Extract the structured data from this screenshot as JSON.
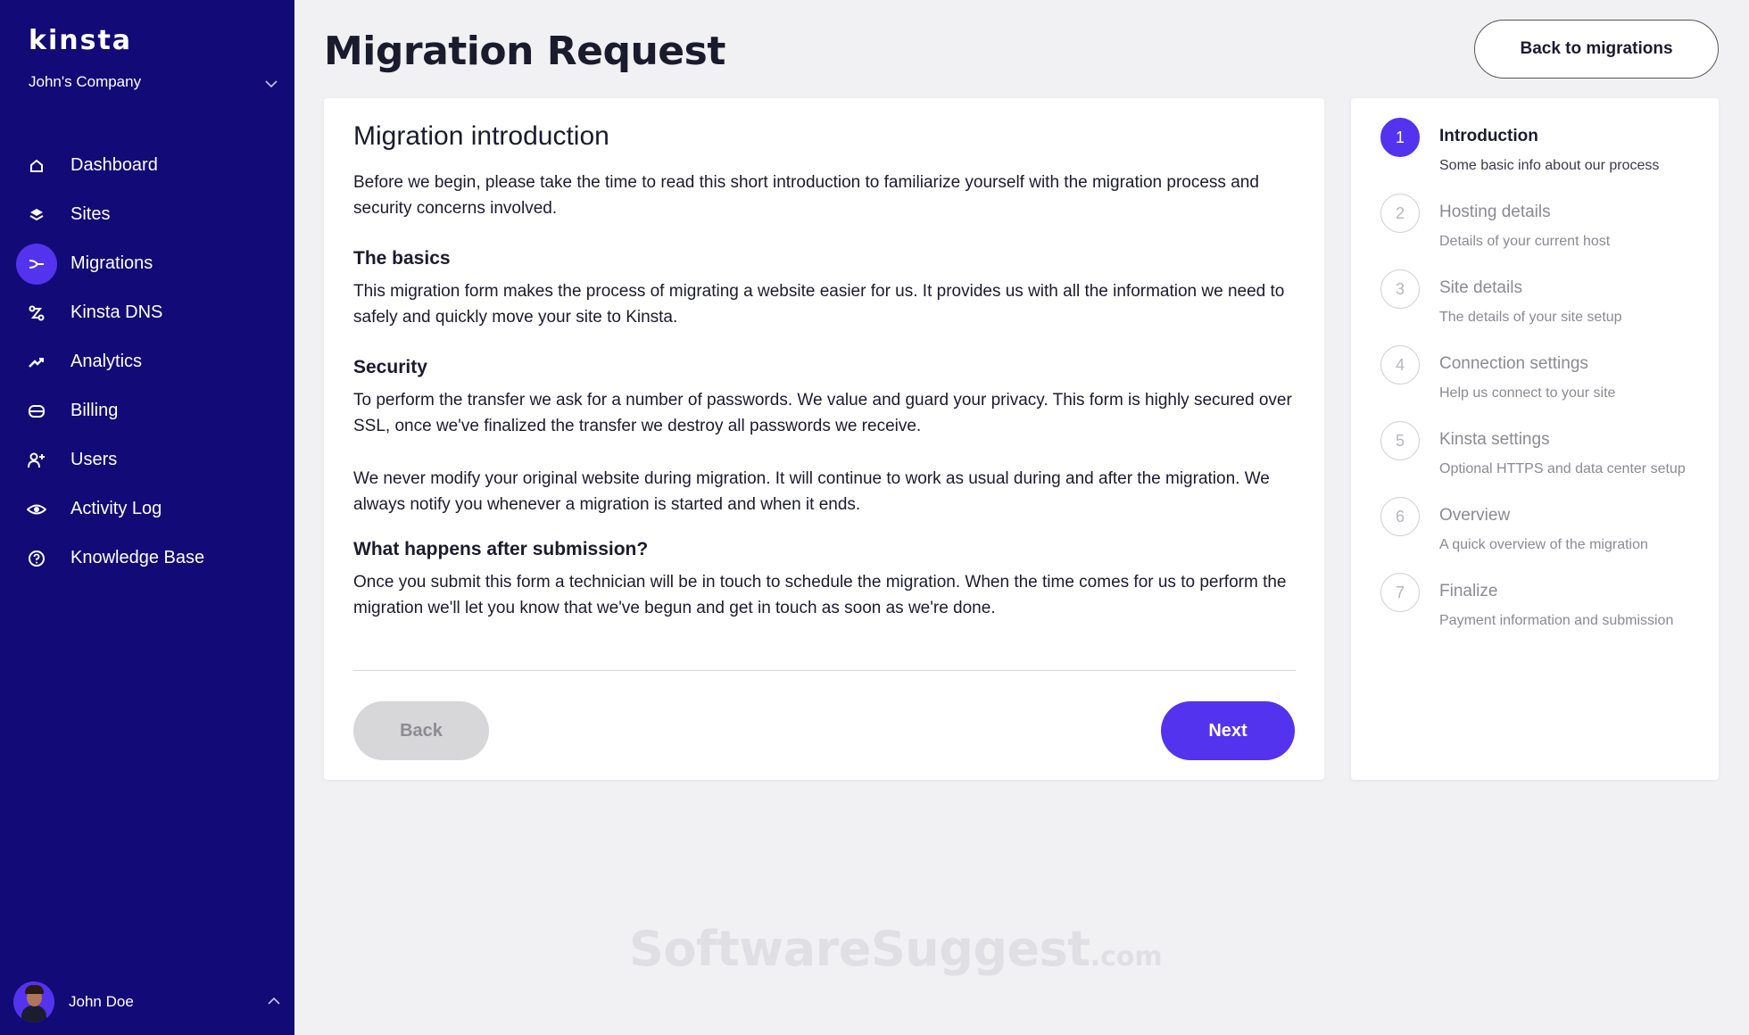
{
  "sidebar": {
    "logo": "kinsta",
    "company": "John's Company",
    "nav": [
      {
        "label": "Dashboard",
        "icon": "home-icon"
      },
      {
        "label": "Sites",
        "icon": "layers-icon"
      },
      {
        "label": "Migrations",
        "icon": "migrate-icon",
        "active": true
      },
      {
        "label": "Kinsta DNS",
        "icon": "dns-icon"
      },
      {
        "label": "Analytics",
        "icon": "trend-icon"
      },
      {
        "label": "Billing",
        "icon": "card-icon"
      },
      {
        "label": "Users",
        "icon": "user-add-icon"
      },
      {
        "label": "Activity Log",
        "icon": "eye-icon"
      },
      {
        "label": "Knowledge Base",
        "icon": "help-icon"
      }
    ],
    "user": "John Doe"
  },
  "header": {
    "title": "Migration Request",
    "back_label": "Back to migrations"
  },
  "card": {
    "title": "Migration introduction",
    "intro": "Before we begin, please take the time to read this short introduction to familiarize yourself with the migration process and security concerns involved.",
    "basics_title": "The basics",
    "basics_text": "This migration form makes the process of migrating a website easier for us. It provides us with all the information we need to safely and quickly move your site to Kinsta.",
    "security_title": "Security",
    "security_text_1": "To perform the transfer we ask for a number of passwords. We value and guard your privacy. This form is highly secured over SSL, once we've finalized the transfer we destroy all passwords we receive.",
    "security_text_2": "We never modify your original website during migration. It will continue to work as usual during and after the migration. We always notify you whenever a migration is started and when it ends.",
    "after_title": "What happens after submission?",
    "after_text": "Once you submit this form a technician will be in touch to schedule the migration. When the time comes for us to perform the migration we'll let you know that we've begun and get in touch as soon as we're done.",
    "back_button": "Back",
    "next_button": "Next"
  },
  "steps": [
    {
      "num": "1",
      "title": "Introduction",
      "sub": "Some basic info about our process",
      "active": true
    },
    {
      "num": "2",
      "title": "Hosting details",
      "sub": "Details of your current host"
    },
    {
      "num": "3",
      "title": "Site details",
      "sub": "The details of your site setup"
    },
    {
      "num": "4",
      "title": "Connection settings",
      "sub": "Help us connect to your site"
    },
    {
      "num": "5",
      "title": "Kinsta settings",
      "sub": "Optional HTTPS and data center setup"
    },
    {
      "num": "6",
      "title": "Overview",
      "sub": "A quick overview of the migration"
    },
    {
      "num": "7",
      "title": "Finalize",
      "sub": "Payment information and submission"
    }
  ],
  "watermark": {
    "main": "SoftwareSuggest",
    "domain": ".com"
  },
  "colors": {
    "sidebar": "#120a76",
    "accent": "#5333ed",
    "background": "#f1f1f4"
  }
}
